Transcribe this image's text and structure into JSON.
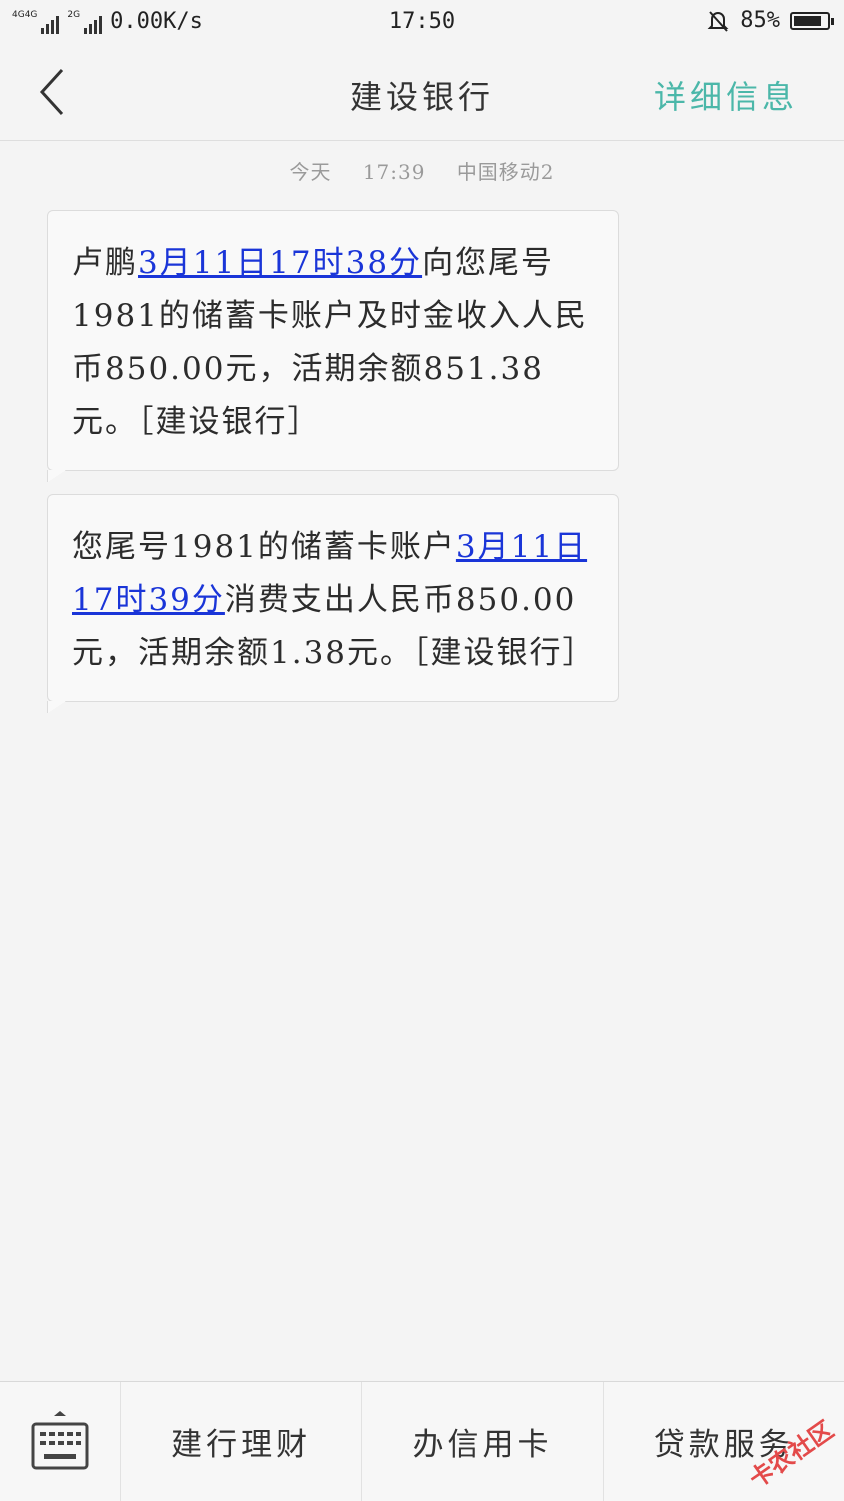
{
  "status_bar": {
    "sim1_label": "4G4G",
    "sim2_label": "2G",
    "net_speed": "0.00K/s",
    "time": "17:50",
    "battery": "85%",
    "battery_level": 0.85
  },
  "header": {
    "back_icon": "chevron-left-icon",
    "title": "建设银行",
    "detail_label": "详细信息"
  },
  "date_line": {
    "day": "今天",
    "time": "17:39",
    "carrier": "中国移动2"
  },
  "messages": [
    {
      "p1": "卢鹏",
      "link": "3月11日17时38分",
      "p2": "向您尾号1981的储蓄卡账户及时金收入人民币850.00元，活期余额851.38元。［建设银行］"
    },
    {
      "p1": "您尾号1981的储蓄卡账户",
      "link": "3月11日17时39分",
      "p2": "消费支出人民币850.00元，活期余额1.38元。［建设银行］"
    }
  ],
  "bottom_bar": {
    "keyboard_icon": "keyboard-icon",
    "items": [
      "建行理财",
      "办信用卡",
      "贷款服务"
    ]
  },
  "watermark": "卡农社区"
}
